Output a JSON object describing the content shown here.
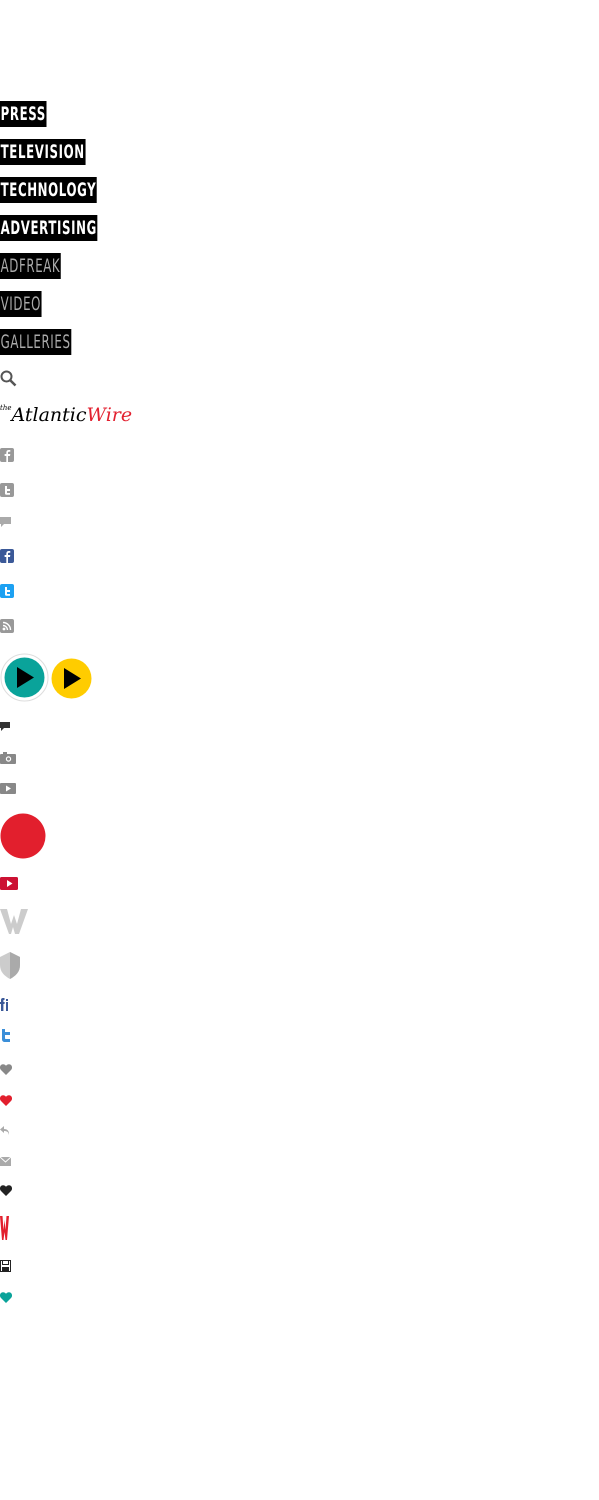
{
  "nav": {
    "items": [
      "PRESS",
      "TELEVISION",
      "TECHNOLOGY",
      "ADVERTISING",
      "ADFREAK",
      "VIDEO",
      "GALLERIES"
    ]
  },
  "logo": {
    "the": "the",
    "atlantic": "Atlantic",
    "wire": "Wire"
  },
  "colors": {
    "black": "#000000",
    "gray": "#999999",
    "facebook": "#3b5998",
    "twitter": "#1da1f2",
    "red": "#e21f2d",
    "teal": "#0aa39a",
    "yellow": "#ffcc00"
  },
  "icons": [
    "search-icon",
    "facebook-gray-icon",
    "twitter-gray-icon",
    "comment-gray-icon",
    "facebook-color-icon",
    "twitter-color-icon",
    "rss-icon",
    "play-teal-icon",
    "play-yellow-icon",
    "comment-dark-icon",
    "camera-icon",
    "video-icon",
    "red-circle-icon",
    "video-red-icon",
    "w-logo-icon",
    "shield-icon",
    "facebook-small-icon",
    "twitter-small-icon",
    "heart-gray-icon",
    "heart-red-icon",
    "reply-icon",
    "email-icon",
    "heart-black-icon",
    "w-red-icon",
    "save-icon",
    "heart-teal-icon"
  ]
}
